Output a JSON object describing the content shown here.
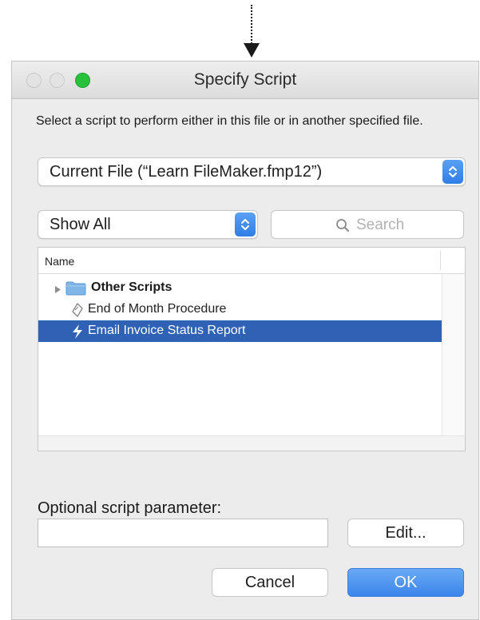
{
  "window": {
    "title": "Specify Script",
    "traffic_lights": [
      "close",
      "minimize",
      "zoom"
    ],
    "accent_color": "#2f62b4"
  },
  "instruction": "Select a script to perform either in this file or in another specified file.",
  "file_popup": {
    "selected": "Current File (“Learn FileMaker.fmp12”)",
    "icon": "stepper-icon"
  },
  "filter_popup": {
    "selected": "Show All",
    "icon": "stepper-icon"
  },
  "search": {
    "placeholder": "Search",
    "value": "",
    "icon": "search-icon"
  },
  "script_list": {
    "column_header": "Name",
    "items": [
      {
        "label": "Other Scripts",
        "type": "folder",
        "icon": "folder-icon",
        "collapsed": true
      },
      {
        "label": "End of Month Procedure",
        "type": "script",
        "icon": "script-icon"
      },
      {
        "label": "Email Invoice Status Report",
        "type": "script",
        "icon": "script-icon",
        "selected": true
      }
    ]
  },
  "parameter": {
    "label": "Optional script parameter:",
    "value": ""
  },
  "buttons": {
    "edit": "Edit...",
    "cancel": "Cancel",
    "ok": "OK"
  }
}
